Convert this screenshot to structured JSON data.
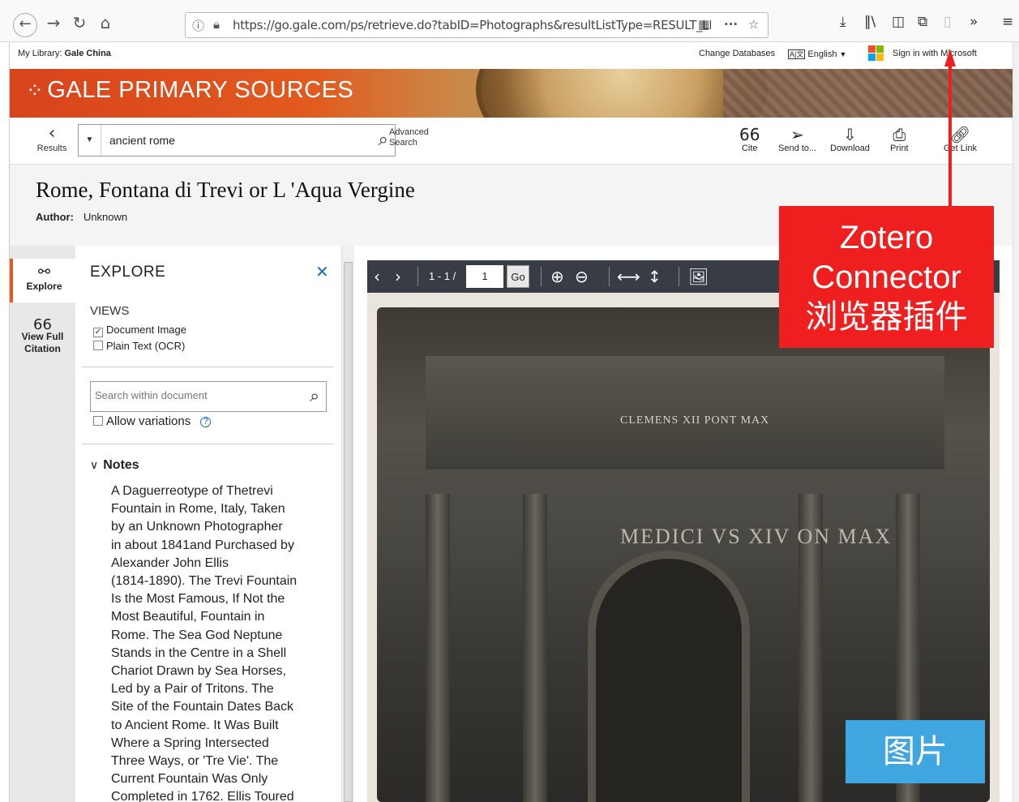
{
  "browser": {
    "url": "https://go.gale.com/ps/retrieve.do?tabID=Photographs&resultListType=RESULT_LIST",
    "icons": [
      "back-icon",
      "forward-icon",
      "reload-icon",
      "home-icon",
      "site-info-icon",
      "lock-icon",
      "qr-icon",
      "more-icon",
      "bookmark-star-icon",
      "download-icon",
      "library-icon",
      "sidebar-icon",
      "extension-icon",
      "zotero-icon",
      "overflow-icon",
      "menu-icon"
    ]
  },
  "libbar": {
    "label": "My Library:",
    "library": "Gale China",
    "change_db": "Change Databases",
    "lang_tag": "A|文",
    "language": "English",
    "sign_in": "Sign in with Microsoft"
  },
  "banner": {
    "title": "GALE PRIMARY SOURCES"
  },
  "toolbar": {
    "results": "Results",
    "search_value": "ancient rome",
    "advanced_line1": "Advanced",
    "advanced_line2": "Search",
    "tools": [
      {
        "label": "Cite",
        "icon": "quote-icon"
      },
      {
        "label": "Send to...",
        "icon": "send-icon"
      },
      {
        "label": "Download",
        "icon": "download-icon"
      },
      {
        "label": "Print",
        "icon": "print-icon"
      },
      {
        "label": "Get Link",
        "icon": "link-icon"
      }
    ]
  },
  "document": {
    "title": "Rome, Fontana di Trevi or L 'Aqua Vergine",
    "author_label": "Author:",
    "author": "Unknown"
  },
  "rail": {
    "explore": "Explore",
    "view_full_1": "View Full",
    "view_full_2": "Citation"
  },
  "explore": {
    "heading": "EXPLORE",
    "views_label": "VIEWS",
    "view_document_image": "Document Image",
    "view_plain_text": "Plain Text (OCR)",
    "search_placeholder": "Search within document",
    "allow_variations": "Allow variations",
    "notes_heading": "Notes",
    "notes_lines": [
      "A Daguerreotype of Thetrevi",
      "Fountain in Rome, Italy, Taken",
      "by an Unknown Photographer",
      "in about 1841and Purchased by",
      "Alexander John Ellis",
      "(1814-1890). The Trevi Fountain",
      "Is the Most Famous, If Not the",
      "Most Beautiful, Fountain in",
      "Rome. The Sea God Neptune",
      "Stands in the Centre in a Shell",
      "Chariot Drawn by Sea Horses,",
      "Led by a Pair of Tritons. The",
      "Site of the Fountain Dates Back",
      "to Ancient Rome. It Was Built",
      "Where a Spring Intersected",
      "Three Ways, or 'Tre Vie'. The",
      "Current Fountain Was Only",
      "Completed in 1762. Ellis Toured"
    ]
  },
  "viewer": {
    "page_range": "1 - 1 /",
    "page_input": "1",
    "go": "Go",
    "inscription_top": "CLEMENS XII PONT MAX",
    "inscription_main": "MEDICI VS XIV  ON MAX"
  },
  "annotations": {
    "zotero_line1": "Zotero",
    "zotero_line2": "Connector",
    "zotero_line3": "浏览器插件",
    "picture_label": "图片",
    "zotero_color": "#f01f1f",
    "picture_color": "#3fa6e0"
  },
  "colors": {
    "accent": "#e25a1e",
    "link": "#1a6db5",
    "viewer_toolbar": "#383d45"
  }
}
